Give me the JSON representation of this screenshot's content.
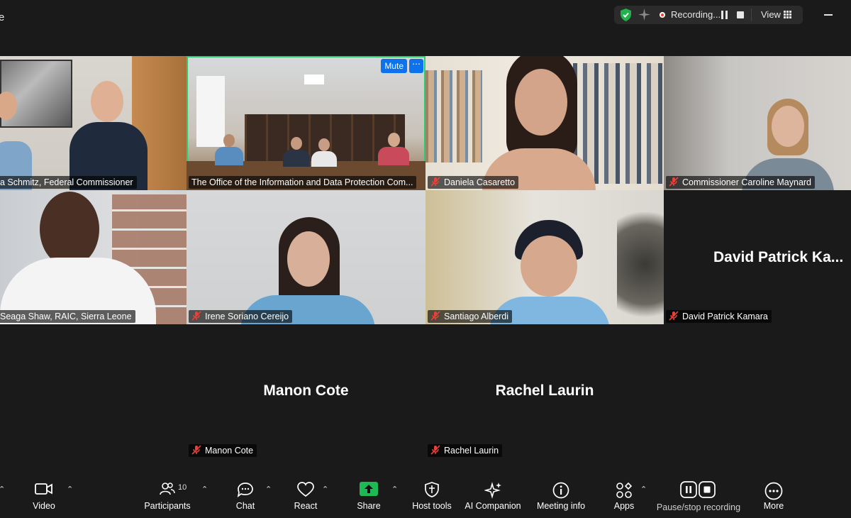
{
  "app": {
    "title_fragment": "e"
  },
  "status_bar": {
    "recording_label": "Recording...",
    "view_label": "View"
  },
  "tiles": [
    {
      "name": "a Schmitz, Federal Commissioner"
    },
    {
      "name": "The Office of the Information and Data Protection Com...",
      "mute_label": "Mute",
      "more_label": "⋯"
    },
    {
      "name": "Daniela Casaretto"
    },
    {
      "name": "Commissioner Caroline Maynard"
    },
    {
      "name": "Seaga Shaw, RAIC, Sierra Leone"
    },
    {
      "name": "Irene Soriano Cereijo"
    },
    {
      "name": "Santiago Alberdi"
    },
    {
      "name": "David Patrick Kamara",
      "center_label": "David Patrick Ka..."
    },
    {
      "name": "Manon Cote",
      "center_label": "Manon Cote"
    },
    {
      "name": "Rachel Laurin",
      "center_label": "Rachel Laurin"
    }
  ],
  "toolbar": {
    "video": "Video",
    "participants": "Participants",
    "participants_count": "10",
    "chat": "Chat",
    "react": "React",
    "share": "Share",
    "host_tools": "Host tools",
    "ai_companion": "AI Companion",
    "meeting_info": "Meeting info",
    "apps": "Apps",
    "pause_stop": "Pause/stop recording",
    "more": "More"
  },
  "colors": {
    "active_border": "#2ecc71",
    "mute_button": "#0e72ed",
    "share_green": "#1db954",
    "recording_red": "#ff3b30",
    "muted_mic_red": "#e8413a"
  }
}
